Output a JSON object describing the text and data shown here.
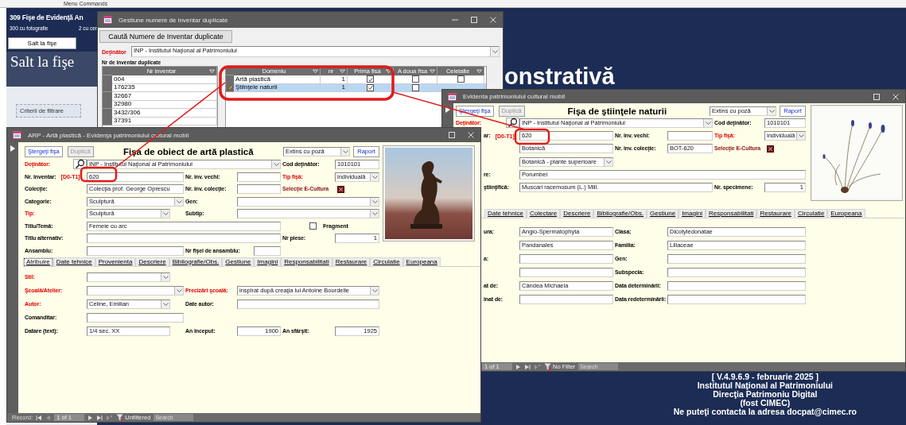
{
  "menu_strip": {
    "label": "Menu Commands"
  },
  "background_app": {
    "title": "309 Fişe de Evidenţă An",
    "photo_count": "300 cu fotografie",
    "other_count": "2 cu cer",
    "jump_button": "Salt la fişe",
    "section_title": "Salt la fişe",
    "filter_box": "Criterii de filtrare",
    "heading": "onstrativă",
    "footer": [
      "[ V.4.9.6.9 - februarie 2025 ]",
      "Institutul Naţional al Patrimoniului",
      "Direcţia Patrimoniu Digital",
      "(fost CIMEC)",
      "Ne puteţi contacta la adresa docpat@cimec.ro"
    ]
  },
  "duplicates_window": {
    "title": "Gestiune numere de inventar duplicate",
    "search_button": "Caută Numere de Inventar duplicate",
    "owner_label": "Deţinător",
    "owner": "INP - Institutul Naţional al Patrimoniului",
    "list_label": "Nr de inventar duplicate",
    "inventory_grid": {
      "columns": [
        "Nr inventar"
      ],
      "rows": [
        "004",
        "176235",
        "32667",
        "32980",
        "3432/306",
        "37391"
      ]
    },
    "domain_grid": {
      "columns": [
        "Domeniu",
        "nr",
        "Prima fisa",
        "A doua fisa",
        "Celelalte"
      ],
      "rows": [
        {
          "domain": "Artă plastică",
          "count": "1",
          "checks": [
            true,
            false,
            false
          ],
          "selected": false,
          "editing": false
        },
        {
          "domain": "Ştiinţele naturii",
          "count": "1",
          "checks": [
            true,
            false
          ],
          "selected": true,
          "editing": true
        }
      ]
    }
  },
  "natural_window": {
    "title": "Evidenta patrimoniului cultural mobil",
    "delete_button": "Ştergeţi fişa",
    "duplicate_button": {
      "label": "Duplică",
      "disabled": true
    },
    "form_title": "Fişa de ştiinţele naturii",
    "view": "Extins cu poză",
    "report_button": "Raport",
    "upper_rows": [
      [
        {
          "kind": "label",
          "text": "Deţinător:",
          "required": true
        },
        {
          "kind": "search"
        },
        {
          "kind": "combo",
          "value": "INP - Institutul Naţional al Patrimoniului"
        },
        {
          "kind": "label",
          "text": "Cod deţinător:",
          "required": false
        },
        {
          "kind": "field",
          "value": "1010101"
        }
      ],
      [
        {
          "kind": "label",
          "text": "ar:",
          "required": false,
          "code": "[D0-T1]"
        },
        {
          "kind": "field",
          "value": "620"
        },
        {
          "kind": "label",
          "text": "Nr. inv. vechi:",
          "required": false
        },
        {
          "kind": "field"
        },
        {
          "kind": "label",
          "text": "Tip fişă:",
          "required": true
        },
        {
          "kind": "combo",
          "value": "individuală"
        }
      ],
      [
        {
          "kind": "field",
          "value": "Botanică"
        },
        {
          "kind": "label",
          "text": "Nr. inv. colecţie:",
          "required": false
        },
        {
          "kind": "field",
          "value": "BOT-620"
        },
        {
          "kind": "caption",
          "text": "Selecţie E-Cultura"
        },
        {
          "kind": "flag"
        }
      ],
      [
        {
          "kind": "combo",
          "value": "Botanică - plante superioare"
        }
      ],
      [
        {
          "kind": "label",
          "text": "re:",
          "required": false
        },
        {
          "kind": "field",
          "value": "Porumbei"
        }
      ],
      [
        {
          "kind": "label",
          "text": "ştiinţifică:",
          "required": false
        },
        {
          "kind": "field",
          "value": "Muscari racemosum (L.) Mill."
        },
        {
          "kind": "label",
          "text": "Nr. specimene:",
          "required": false
        },
        {
          "kind": "number",
          "value": "1"
        }
      ]
    ],
    "tabs": [
      {
        "label": "Date tehnice",
        "selected": false
      },
      {
        "label": "Colectare",
        "selected": false
      },
      {
        "label": "Descriere",
        "selected": false
      },
      {
        "label": "Bibliografie/Obs.",
        "selected": false
      },
      {
        "label": "Gestiune",
        "selected": false
      },
      {
        "label": "Imagini",
        "selected": false
      },
      {
        "label": "Responsabilitati",
        "selected": false
      },
      {
        "label": "Restaurare",
        "selected": false
      },
      {
        "label": "Circulatie",
        "selected": false
      },
      {
        "label": "Europeana",
        "selected": false
      }
    ],
    "lower_rows": [
      [
        {
          "kind": "label",
          "text": "ura:",
          "required": false
        },
        {
          "kind": "field",
          "value": "Angio-Spermatophyta"
        },
        {
          "kind": "label",
          "text": "Clasa:",
          "required": false
        },
        {
          "kind": "field",
          "value": "Dicotyledonatae"
        }
      ],
      [
        {
          "kind": "field",
          "value": "Pandanales"
        },
        {
          "kind": "label",
          "text": "Familia:",
          "required": false
        },
        {
          "kind": "field",
          "value": "Liliaceae"
        }
      ],
      [
        {
          "kind": "label",
          "text": "a:",
          "required": false
        },
        {
          "kind": "field"
        },
        {
          "kind": "label",
          "text": "Gen:",
          "required": false
        },
        {
          "kind": "field"
        }
      ],
      [
        {
          "kind": "field"
        },
        {
          "kind": "label",
          "text": "Subspecia:",
          "required": false
        },
        {
          "kind": "field"
        }
      ],
      [
        {
          "kind": "label",
          "text": "at de:",
          "required": false
        },
        {
          "kind": "field",
          "value": "Cândea Michaela"
        },
        {
          "kind": "label",
          "text": "Data determinării:",
          "required": false
        },
        {
          "kind": "field"
        }
      ],
      [
        {
          "kind": "label",
          "text": "inat de:",
          "required": false
        },
        {
          "kind": "field"
        },
        {
          "kind": "label",
          "text": "Data redeterminării:",
          "required": false
        },
        {
          "kind": "field"
        }
      ]
    ],
    "nav": {
      "position": "1 of 1",
      "filter": "No Filter",
      "search": {
        "placeholder": "Search"
      }
    }
  },
  "art_window": {
    "title": "ARP - Artă plastică - Evidenţa patrimoniului cultural mobil",
    "delete_button": "Ştergeţi fişa",
    "duplicate_button": {
      "label": "Duplică",
      "disabled": true
    },
    "form_title": "Fişa de obiect de artă plastică",
    "view": "Extins cu poză",
    "report_button": "Raport",
    "upper_rows": [
      [
        {
          "kind": "label",
          "text": "Deţinător:",
          "required": true
        },
        {
          "kind": "search"
        },
        {
          "kind": "combo",
          "value": "INP - Institutul Naţional al Patrimoniului"
        },
        {
          "kind": "label",
          "text": "Cod deţinător:",
          "required": false
        },
        {
          "kind": "field",
          "value": "1010101"
        }
      ],
      [
        {
          "kind": "label",
          "text": "Nr. inventar:",
          "required": false,
          "code": "[D0-T1]"
        },
        {
          "kind": "field",
          "value": "620"
        },
        {
          "kind": "label",
          "text": "Nr. inv. vechi:",
          "required": false
        },
        {
          "kind": "field"
        },
        {
          "kind": "label",
          "text": "Tip fişă:",
          "required": true
        },
        {
          "kind": "combo",
          "value": "individuală"
        }
      ],
      [
        {
          "kind": "label",
          "text": "Colecţie:",
          "required": false
        },
        {
          "kind": "field",
          "value": "Colecţia prof. George Oprescu"
        },
        {
          "kind": "label",
          "text": "Nr. inv. colecţie:",
          "required": false
        },
        {
          "kind": "field"
        },
        {
          "kind": "caption",
          "text": "Selecţie E-Cultura"
        },
        {
          "kind": "flag"
        }
      ],
      [
        {
          "kind": "label",
          "text": "Categorie:",
          "required": false
        },
        {
          "kind": "combo",
          "value": "Sculptură"
        },
        {
          "kind": "label",
          "text": "Gen:",
          "required": false
        },
        {
          "kind": "combo"
        }
      ],
      [
        {
          "kind": "label",
          "text": "Tip:",
          "required": true
        },
        {
          "kind": "combo",
          "value": "Sculptură"
        },
        {
          "kind": "label",
          "text": "Subtip:",
          "required": false
        },
        {
          "kind": "combo"
        }
      ],
      [
        {
          "kind": "label",
          "text": "Titlu/Temă:",
          "required": false
        },
        {
          "kind": "field",
          "value": "Femeie cu arc"
        },
        {
          "kind": "check",
          "text": "Fragment",
          "checked": false
        }
      ],
      [
        {
          "kind": "label",
          "text": "Titlu alternativ:",
          "required": false
        },
        {
          "kind": "field"
        },
        {
          "kind": "label",
          "text": "Nr piese:",
          "required": false
        },
        {
          "kind": "number",
          "value": "1"
        }
      ],
      [
        {
          "kind": "label",
          "text": "Ansamblu:",
          "required": false
        },
        {
          "kind": "field"
        },
        {
          "kind": "label",
          "text": "Nr fişei de ansamblu:",
          "required": false
        },
        {
          "kind": "field"
        }
      ]
    ],
    "tabs": [
      {
        "label": "Atribuire",
        "selected": true
      },
      {
        "label": "Date tehnice",
        "selected": false
      },
      {
        "label": "Provenienta",
        "selected": false
      },
      {
        "label": "Descriere",
        "selected": false
      },
      {
        "label": "Bibliografie/Obs.",
        "selected": false
      },
      {
        "label": "Gestiune",
        "selected": false
      },
      {
        "label": "Imagini",
        "selected": false
      },
      {
        "label": "Responsabilitati",
        "selected": false
      },
      {
        "label": "Restaurare",
        "selected": false
      },
      {
        "label": "Circulatie",
        "selected": false
      },
      {
        "label": "Europeana",
        "selected": false
      }
    ],
    "lower_rows": [
      [
        {
          "kind": "label",
          "text": "Stil:",
          "required": true
        },
        {
          "kind": "combo"
        }
      ],
      [
        {
          "kind": "label",
          "text": "Şcoală/Atelier:",
          "required": true
        },
        {
          "kind": "combo"
        },
        {
          "kind": "label",
          "text": "Precizări şcoală:",
          "required": true
        },
        {
          "kind": "combo",
          "value": "inspirat după creaţia lui Antoine Bourdelle"
        }
      ],
      [
        {
          "kind": "label",
          "text": "Autor:",
          "required": true
        },
        {
          "kind": "combo",
          "value": "Celine,  Emilian"
        },
        {
          "kind": "label",
          "text": "Date autor:",
          "required": false
        },
        {
          "kind": "field"
        }
      ],
      [
        {
          "kind": "label",
          "text": "Comanditar:",
          "required": false
        },
        {
          "kind": "field"
        }
      ],
      [
        {
          "kind": "label",
          "text": "Datare (text):",
          "required": false
        },
        {
          "kind": "field",
          "value": "1/4 sec. XX"
        },
        {
          "kind": "label",
          "text": "An început:",
          "required": false
        },
        {
          "kind": "number",
          "value": "1900"
        },
        {
          "kind": "label",
          "text": "An sfârşit:",
          "required": false
        },
        {
          "kind": "number",
          "value": "1925"
        }
      ]
    ],
    "nav": {
      "label": "Record:",
      "position": "1 of 1",
      "filter": "Unfiltered",
      "search": {
        "placeholder": "Search"
      }
    }
  }
}
